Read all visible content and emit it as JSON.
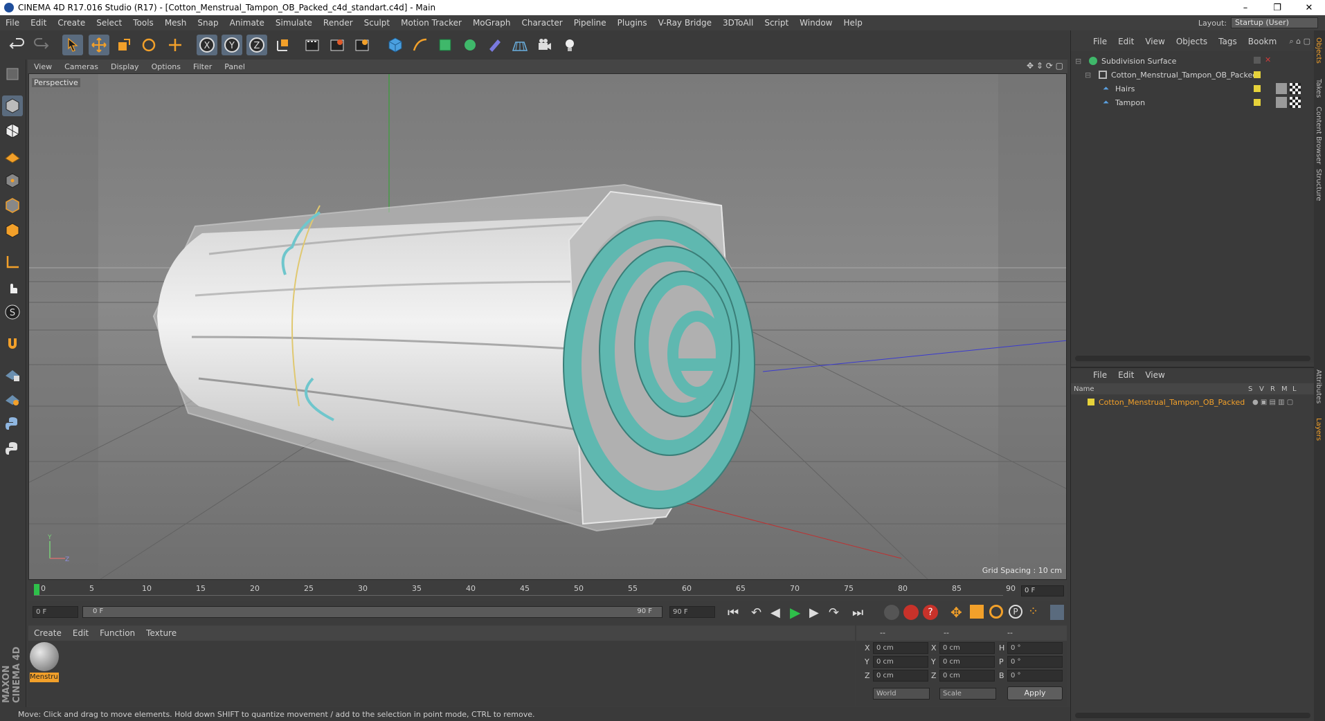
{
  "window": {
    "title": "CINEMA 4D R17.016 Studio (R17) - [Cotton_Menstrual_Tampon_OB_Packed_c4d_standart.c4d] - Main",
    "controls": [
      "–",
      "❐",
      "✕"
    ]
  },
  "menubar": {
    "items": [
      "File",
      "Edit",
      "Create",
      "Select",
      "Tools",
      "Mesh",
      "Snap",
      "Animate",
      "Simulate",
      "Render",
      "Sculpt",
      "Motion Tracker",
      "MoGraph",
      "Character",
      "Pipeline",
      "Plugins",
      "V-Ray Bridge",
      "3DToAll",
      "Script",
      "Window",
      "Help"
    ],
    "layout_label": "Layout:",
    "layout_value": "Startup (User)"
  },
  "viewport": {
    "menu": [
      "View",
      "Cameras",
      "Display",
      "Options",
      "Filter",
      "Panel"
    ],
    "camera_label": "Perspective",
    "grid_spacing": "Grid Spacing : 10 cm"
  },
  "timeline": {
    "ticks": [
      "0",
      "5",
      "10",
      "15",
      "20",
      "25",
      "30",
      "35",
      "40",
      "45",
      "50",
      "55",
      "60",
      "65",
      "70",
      "75",
      "80",
      "85",
      "90"
    ],
    "current_frame": "0 F",
    "start_field": "0 F",
    "range_start": "0 F",
    "range_end": "90 F",
    "end_field": "90 F"
  },
  "material_editor": {
    "menu": [
      "Create",
      "Edit",
      "Function",
      "Texture"
    ],
    "material_name": "Menstru"
  },
  "coordinates": {
    "header": [
      "--",
      "--",
      "--"
    ],
    "rows": [
      {
        "a": "X",
        "av": "0 cm",
        "b": "X",
        "bv": "0 cm",
        "c": "H",
        "cv": "0 °"
      },
      {
        "a": "Y",
        "av": "0 cm",
        "b": "Y",
        "bv": "0 cm",
        "c": "P",
        "cv": "0 °"
      },
      {
        "a": "Z",
        "av": "0 cm",
        "b": "Z",
        "bv": "0 cm",
        "c": "B",
        "cv": "0 °"
      }
    ],
    "mode1": "World",
    "mode2": "Scale",
    "apply": "Apply"
  },
  "status": "Move: Click and drag to move elements. Hold down SHIFT to quantize movement / add to the selection in point mode, CTRL to remove.",
  "object_manager": {
    "menu": [
      "File",
      "Edit",
      "View",
      "Objects",
      "Tags",
      "Bookm"
    ],
    "objects": [
      {
        "name": "Subdivision Surface",
        "indent": 0
      },
      {
        "name": "Cotton_Menstrual_Tampon_OB_Packed",
        "indent": 1
      },
      {
        "name": "Hairs",
        "indent": 2
      },
      {
        "name": "Tampon",
        "indent": 2
      }
    ]
  },
  "layer_manager": {
    "menu": [
      "File",
      "Edit",
      "View"
    ],
    "columns": [
      "Name",
      "S",
      "V",
      "R",
      "M",
      "L"
    ],
    "layer_name": "Cotton_Menstrual_Tampon_OB_Packed"
  },
  "side_tabs": [
    "Objects",
    "Takes",
    "Content Browser",
    "Structure",
    "Attributes",
    "Layers"
  ],
  "brand": "MAXON CINEMA 4D",
  "colors": {
    "accent": "#f2a02a",
    "tampon_string": "#5fb8b0",
    "viewport_bg": "#737373"
  }
}
